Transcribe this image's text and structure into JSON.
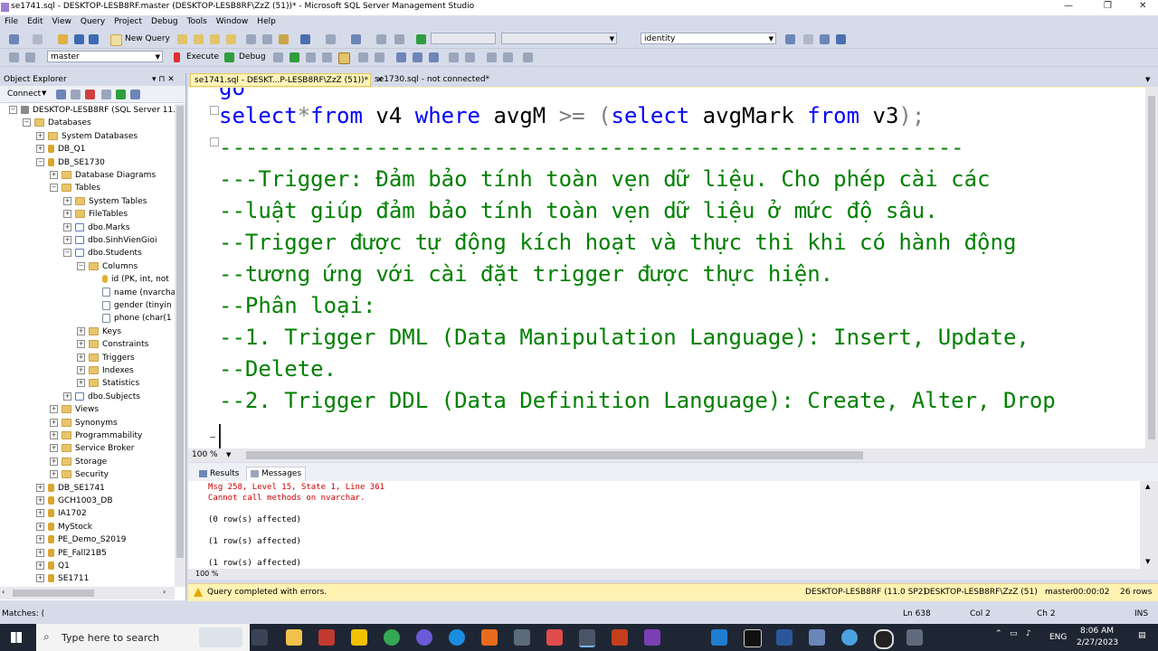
{
  "window": {
    "title": "se1741.sql - DESKTOP-LESB8RF.master (DESKTOP-LESB8RF\\ZzZ (51))* - Microsoft SQL Server Management Studio",
    "controls": {
      "minimize": "—",
      "restore": "❐",
      "close": "✕"
    }
  },
  "menu": [
    "File",
    "Edit",
    "View",
    "Query",
    "Project",
    "Debug",
    "Tools",
    "Window",
    "Help"
  ],
  "toolbar1": {
    "new_query": "New Query",
    "search_value": "identity"
  },
  "toolbar2": {
    "database": "master",
    "execute": "Execute",
    "debug": "Debug"
  },
  "object_explorer": {
    "title": "Object Explorer",
    "pin": "▾ ⊓ ✕",
    "connect": "Connect",
    "tree": [
      {
        "label": "DESKTOP-LESB8RF (SQL Server 11.0",
        "level": 0,
        "icon": "server-icon",
        "expander": "−"
      },
      {
        "label": "Databases",
        "level": 1,
        "icon": "folder-icon",
        "expander": "−"
      },
      {
        "label": "System Databases",
        "level": 2,
        "icon": "folder-icon",
        "expander": "+"
      },
      {
        "label": "DB_Q1",
        "level": 2,
        "icon": "database-icon",
        "expander": "+"
      },
      {
        "label": "DB_SE1730",
        "level": 2,
        "icon": "database-icon",
        "expander": "−"
      },
      {
        "label": "Database Diagrams",
        "level": 3,
        "icon": "folder-icon",
        "expander": "+"
      },
      {
        "label": "Tables",
        "level": 3,
        "icon": "folder-icon",
        "expander": "−"
      },
      {
        "label": "System Tables",
        "level": 4,
        "icon": "folder-icon",
        "expander": "+"
      },
      {
        "label": "FileTables",
        "level": 4,
        "icon": "folder-icon",
        "expander": "+"
      },
      {
        "label": "dbo.Marks",
        "level": 4,
        "icon": "table-icon",
        "expander": "+"
      },
      {
        "label": "dbo.SinhVienGioi",
        "level": 4,
        "icon": "table-icon",
        "expander": "+"
      },
      {
        "label": "dbo.Students",
        "level": 4,
        "icon": "table-icon",
        "expander": "−"
      },
      {
        "label": "Columns",
        "level": 5,
        "icon": "folder-icon",
        "expander": "−"
      },
      {
        "label": "id (PK, int, not",
        "level": 6,
        "icon": "key-icon",
        "expander": ""
      },
      {
        "label": "name (nvarcha",
        "level": 6,
        "icon": "column-icon",
        "expander": ""
      },
      {
        "label": "gender (tinyin",
        "level": 6,
        "icon": "column-icon",
        "expander": ""
      },
      {
        "label": "phone (char(1",
        "level": 6,
        "icon": "column-icon",
        "expander": ""
      },
      {
        "label": "Keys",
        "level": 5,
        "icon": "folder-icon",
        "expander": "+"
      },
      {
        "label": "Constraints",
        "level": 5,
        "icon": "folder-icon",
        "expander": "+"
      },
      {
        "label": "Triggers",
        "level": 5,
        "icon": "folder-icon",
        "expander": "+"
      },
      {
        "label": "Indexes",
        "level": 5,
        "icon": "folder-icon",
        "expander": "+"
      },
      {
        "label": "Statistics",
        "level": 5,
        "icon": "folder-icon",
        "expander": "+"
      },
      {
        "label": "dbo.Subjects",
        "level": 4,
        "icon": "table-icon",
        "expander": "+"
      },
      {
        "label": "Views",
        "level": 3,
        "icon": "folder-icon",
        "expander": "+"
      },
      {
        "label": "Synonyms",
        "level": 3,
        "icon": "folder-icon",
        "expander": "+"
      },
      {
        "label": "Programmability",
        "level": 3,
        "icon": "folder-icon",
        "expander": "+"
      },
      {
        "label": "Service Broker",
        "level": 3,
        "icon": "folder-icon",
        "expander": "+"
      },
      {
        "label": "Storage",
        "level": 3,
        "icon": "folder-icon",
        "expander": "+"
      },
      {
        "label": "Security",
        "level": 3,
        "icon": "folder-icon",
        "expander": "+"
      },
      {
        "label": "DB_SE1741",
        "level": 2,
        "icon": "database-icon",
        "expander": "+"
      },
      {
        "label": "GCH1003_DB",
        "level": 2,
        "icon": "database-icon",
        "expander": "+"
      },
      {
        "label": "IA1702",
        "level": 2,
        "icon": "database-icon",
        "expander": "+"
      },
      {
        "label": "MyStock",
        "level": 2,
        "icon": "database-icon",
        "expander": "+"
      },
      {
        "label": "PE_Demo_S2019",
        "level": 2,
        "icon": "database-icon",
        "expander": "+"
      },
      {
        "label": "PE_Fall21B5",
        "level": 2,
        "icon": "database-icon",
        "expander": "+"
      },
      {
        "label": "Q1",
        "level": 2,
        "icon": "database-icon",
        "expander": "+"
      },
      {
        "label": "SE1711",
        "level": 2,
        "icon": "database-icon",
        "expander": "+"
      }
    ]
  },
  "tabs": [
    {
      "label": "se1741.sql - DESKT...P-LESB8RF\\ZzZ (51))*",
      "close": "✕",
      "active": true
    },
    {
      "label": "se1730.sql - not connected*",
      "active": false
    }
  ],
  "editor": {
    "lines": [
      {
        "segments": [
          {
            "t": "go",
            "c": "kw"
          }
        ]
      },
      {
        "segments": [
          {
            "t": "select",
            "c": "kw"
          },
          {
            "t": "*",
            "c": "op"
          },
          {
            "t": "from",
            "c": "kw"
          },
          {
            "t": " v4 ",
            "c": ""
          },
          {
            "t": "where",
            "c": "kw"
          },
          {
            "t": " avgM ",
            "c": ""
          },
          {
            "t": ">=",
            "c": "op"
          },
          {
            "t": " ",
            "c": ""
          },
          {
            "t": "(",
            "c": "op"
          },
          {
            "t": "select",
            "c": "kw"
          },
          {
            "t": " avgMark ",
            "c": ""
          },
          {
            "t": "from",
            "c": "kw"
          },
          {
            "t": " v3",
            "c": ""
          },
          {
            "t": ");",
            "c": "op"
          }
        ]
      },
      {
        "segments": [
          {
            "t": "---------------------------------------------------------",
            "c": "cm"
          }
        ]
      },
      {
        "segments": [
          {
            "t": "---Trigger: Đảm bảo tính toàn vẹn dữ liệu. Cho phép cài các",
            "c": "cm"
          }
        ]
      },
      {
        "segments": [
          {
            "t": "--luật giúp đảm bảo tính toàn vẹn dữ liệu ở mức độ sâu.",
            "c": "cm"
          }
        ]
      },
      {
        "segments": [
          {
            "t": "--Trigger được tự động kích hoạt và thực thi khi có hành động",
            "c": "cm"
          }
        ]
      },
      {
        "segments": [
          {
            "t": "--tương ứng với cài đặt trigger được thực hiện.",
            "c": "cm"
          }
        ]
      },
      {
        "segments": [
          {
            "t": "--Phân loại:",
            "c": "cm"
          }
        ]
      },
      {
        "segments": [
          {
            "t": "--1. Trigger DML (Data Manipulation Language): Insert, Update,",
            "c": "cm"
          }
        ]
      },
      {
        "segments": [
          {
            "t": "--Delete.",
            "c": "cm"
          }
        ]
      },
      {
        "segments": [
          {
            "t": "--2. Trigger DDL (Data Definition Language): Create, Alter, Drop",
            "c": "cm"
          }
        ]
      }
    ],
    "zoom": "100 %"
  },
  "results": {
    "tabs": [
      "Results",
      "Messages"
    ],
    "messages": [
      {
        "text": "Msg 258, Level 15, State 1, Line 361",
        "type": "err"
      },
      {
        "text": "Cannot call methods on nvarchar.",
        "type": "err"
      },
      {
        "text": "(0 row(s) affected)",
        "type": ""
      },
      {
        "text": "(1 row(s) affected)",
        "type": ""
      },
      {
        "text": "(1 row(s) affected)",
        "type": ""
      }
    ],
    "zoom": "100 %"
  },
  "query_status": {
    "message": "Query completed with errors.",
    "server": "DESKTOP-LESB8RF (11.0 SP2)",
    "user": "DESKTOP-LESB8RF\\ZzZ (51)",
    "database": "master",
    "elapsed": "00:00:02",
    "rows": "26 rows"
  },
  "app_status": {
    "left": "Matches: (",
    "ln": "Ln 638",
    "col": "Col 2",
    "ch": "Ch 2",
    "mode": "INS"
  },
  "taskbar": {
    "search_placeholder": "Type here to search",
    "lang": "ENG",
    "time": "8:06 AM",
    "date": "2/27/2023"
  }
}
